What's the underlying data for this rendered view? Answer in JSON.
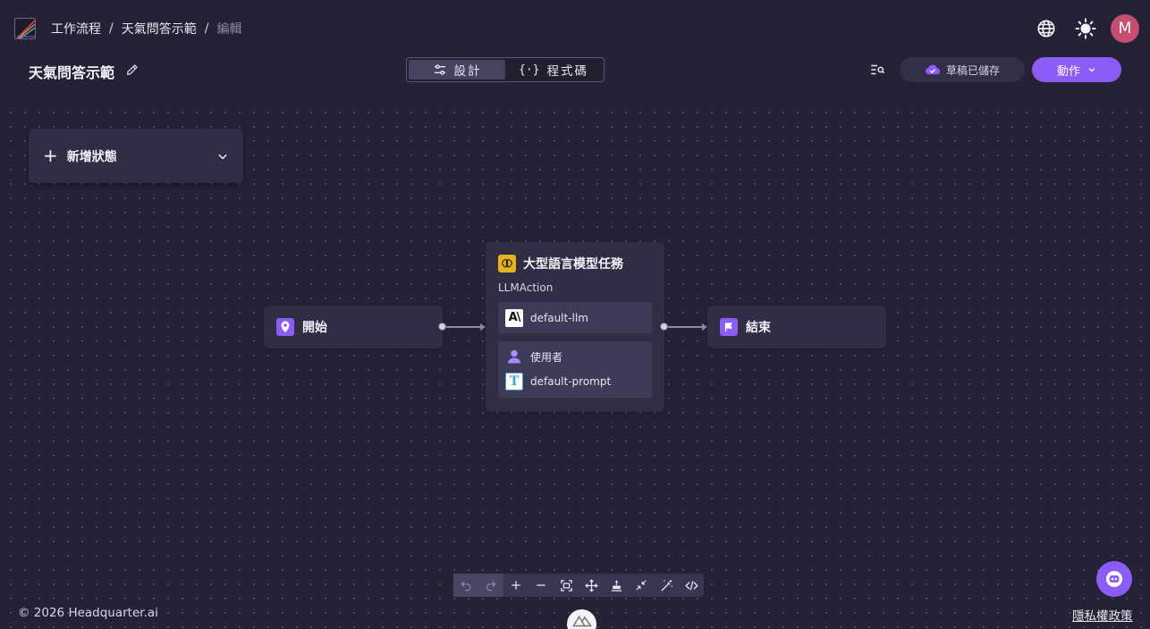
{
  "breadcrumb": {
    "workflows": "工作流程",
    "workflow_name": "天氣問答示範",
    "current": "編輯"
  },
  "user": {
    "avatar_initial": "M"
  },
  "workflow": {
    "title": "天氣問答示範"
  },
  "view_toggle": {
    "design_label": "設計",
    "code_label": "程式碼",
    "active": "design"
  },
  "header_actions": {
    "draft_status": "草稿已儲存",
    "action_label": "動作"
  },
  "add_state": {
    "label": "新增狀態"
  },
  "nodes": {
    "start": {
      "label": "開始",
      "icon": "map-pin-icon"
    },
    "llm": {
      "title": "大型語言模型任務",
      "type": "LLMAction",
      "model": "default-llm",
      "model_icon_text": "A\\",
      "role": "使用者",
      "prompt": "default-prompt",
      "prompt_icon_text": "T"
    },
    "end": {
      "label": "結束",
      "icon": "flag-icon"
    }
  },
  "toolbar": {
    "buttons": [
      "undo-icon",
      "redo-icon",
      "zoom-in-icon",
      "zoom-out-icon",
      "fit-view-icon",
      "move-icon",
      "align-icon",
      "collapse-icon",
      "magic-wand-icon",
      "code-icon"
    ]
  },
  "footer": {
    "copyright": "© 2026 Headquarter.ai",
    "privacy": "隱私權政策"
  },
  "colors": {
    "accent": "#8b5cf6",
    "background": "#262236",
    "node": "#312d45",
    "llm_icon": "#e6b422",
    "avatar": "#c44d70"
  }
}
